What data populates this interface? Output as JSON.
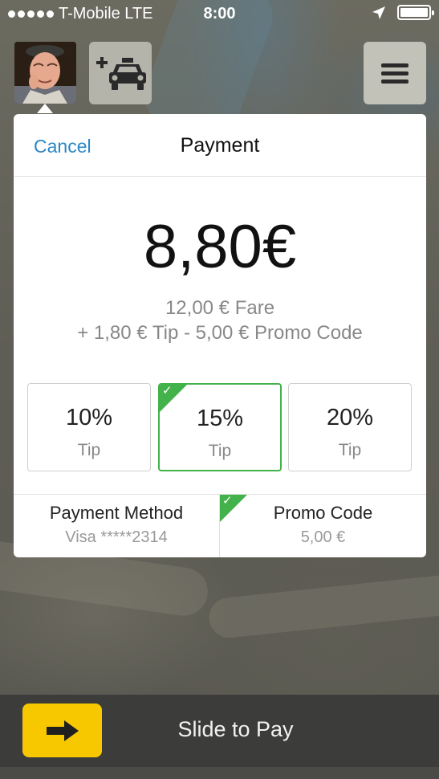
{
  "status_bar": {
    "carrier": "T-Mobile LTE",
    "time": "8:00",
    "location_icon": "location-arrow-icon",
    "battery_icon": "battery-full-icon"
  },
  "top_controls": {
    "avatar_icon": "user-avatar",
    "add_taxi_icon": "add-taxi-icon",
    "menu_icon": "hamburger-menu-icon"
  },
  "payment": {
    "cancel_label": "Cancel",
    "title": "Payment",
    "total": "8,80€",
    "fare_line": "12,00 € Fare",
    "breakdown_line": "+ 1,80 € Tip - 5,00 € Promo Code",
    "tip_options": [
      {
        "percent": "10%",
        "label": "Tip",
        "selected": false
      },
      {
        "percent": "15%",
        "label": "Tip",
        "selected": true
      },
      {
        "percent": "20%",
        "label": "Tip",
        "selected": false
      }
    ],
    "payment_method": {
      "title": "Payment Method",
      "value": "Visa *****2314"
    },
    "promo_code": {
      "title": "Promo Code",
      "value": "5,00 €",
      "selected": true
    }
  },
  "slide_to_pay": {
    "label": "Slide to Pay",
    "handle_icon": "arrow-right-icon"
  },
  "colors": {
    "accent_link": "#2a86c5",
    "selected_green": "#43b24a",
    "slider_yellow": "#f7c800"
  }
}
